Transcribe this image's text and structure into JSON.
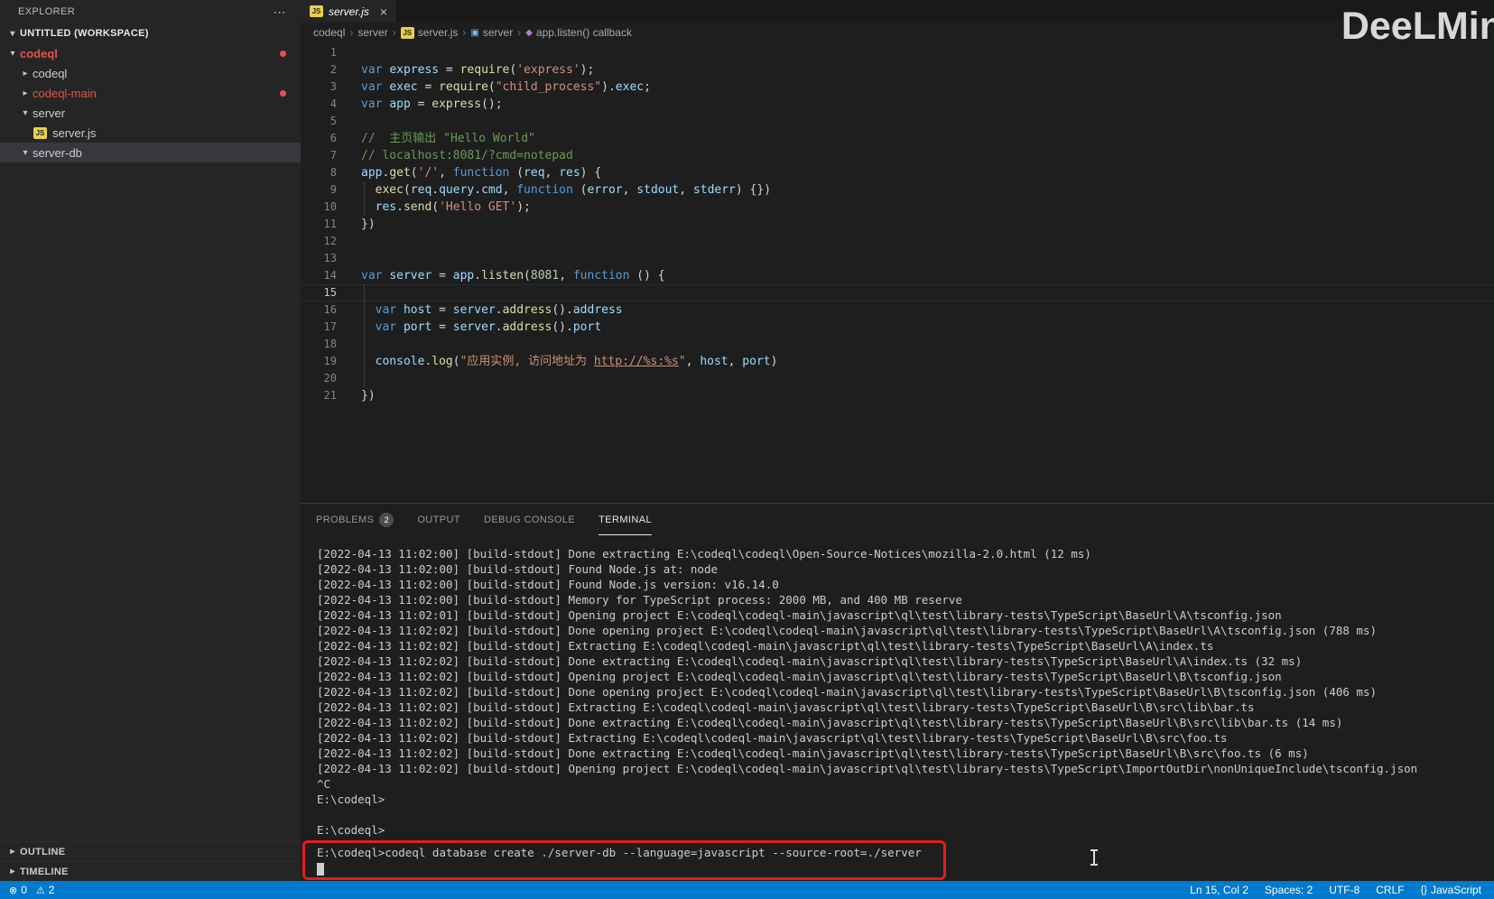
{
  "colors": {
    "status_bar": "#007acc",
    "red_highlight": "#e55349",
    "annotation": "#e51c1c",
    "js_badge": "#e8cf4e"
  },
  "watermark": "DeeLMin",
  "icons": {
    "js_label": "JS",
    "ellipsis": "⋯",
    "chevron_down": "▾",
    "chevron_right": "▸",
    "close": "×",
    "separator": "›",
    "symbol_field": "▣",
    "symbol_method": "◆"
  },
  "sidebar": {
    "header": "EXPLORER",
    "workspace_label": "UNTITLED (WORKSPACE)",
    "tree": [
      {
        "label": "codeql",
        "chevron": "expanded",
        "red": true,
        "bold": true,
        "dot": true,
        "indent": 0
      },
      {
        "label": "codeql",
        "chevron": "collapsed",
        "indent": 1
      },
      {
        "label": "codeql-main",
        "chevron": "collapsed",
        "red": true,
        "dot": true,
        "indent": 1
      },
      {
        "label": "server",
        "chevron": "expanded",
        "indent": 1
      },
      {
        "label": "server.js",
        "file": "js",
        "indent": 2
      },
      {
        "label": "server-db",
        "chevron": "expanded",
        "selected": true,
        "indent": 1
      }
    ],
    "sections": [
      "OUTLINE",
      "TIMELINE"
    ]
  },
  "editor": {
    "tab": {
      "label": "server.js"
    },
    "breadcrumbs": [
      {
        "label": "codeql"
      },
      {
        "label": "server"
      },
      {
        "label": "server.js",
        "icon": "js"
      },
      {
        "label": "server",
        "icon": "symbol-field"
      },
      {
        "label": "app.listen() callback",
        "icon": "symbol-method"
      }
    ],
    "code": {
      "current_line": 15,
      "lines": [
        [],
        [
          [
            "k",
            "var "
          ],
          [
            "v",
            "express"
          ],
          [
            "p",
            " = "
          ],
          [
            "f",
            "require"
          ],
          [
            "p",
            "("
          ],
          [
            "s",
            "'express'"
          ],
          [
            "p",
            ");"
          ]
        ],
        [
          [
            "k",
            "var "
          ],
          [
            "v",
            "exec"
          ],
          [
            "p",
            " = "
          ],
          [
            "f",
            "require"
          ],
          [
            "p",
            "("
          ],
          [
            "s",
            "\"child_process\""
          ],
          [
            "p",
            ")."
          ],
          [
            "v",
            "exec"
          ],
          [
            "p",
            ";"
          ]
        ],
        [
          [
            "k",
            "var "
          ],
          [
            "v",
            "app"
          ],
          [
            "p",
            " = "
          ],
          [
            "f",
            "express"
          ],
          [
            "p",
            "();"
          ]
        ],
        [],
        [
          [
            "c",
            "//  主页输出 \"Hello World\""
          ]
        ],
        [
          [
            "c",
            "// localhost:8081/?cmd=notepad"
          ]
        ],
        [
          [
            "v",
            "app"
          ],
          [
            "p",
            "."
          ],
          [
            "f",
            "get"
          ],
          [
            "p",
            "("
          ],
          [
            "s",
            "'/'"
          ],
          [
            "p",
            ", "
          ],
          [
            "k",
            "function"
          ],
          [
            "p",
            " ("
          ],
          [
            "v",
            "req"
          ],
          [
            "p",
            ", "
          ],
          [
            "v",
            "res"
          ],
          [
            "p",
            ") {"
          ]
        ],
        [
          [
            "p",
            "  "
          ],
          [
            "f",
            "exec"
          ],
          [
            "p",
            "("
          ],
          [
            "v",
            "req"
          ],
          [
            "p",
            "."
          ],
          [
            "v",
            "query"
          ],
          [
            "p",
            "."
          ],
          [
            "v",
            "cmd"
          ],
          [
            "p",
            ", "
          ],
          [
            "k",
            "function"
          ],
          [
            "p",
            " ("
          ],
          [
            "v",
            "error"
          ],
          [
            "p",
            ", "
          ],
          [
            "v",
            "stdout"
          ],
          [
            "p",
            ", "
          ],
          [
            "v",
            "stderr"
          ],
          [
            "p",
            ") {})"
          ]
        ],
        [
          [
            "p",
            "  "
          ],
          [
            "v",
            "res"
          ],
          [
            "p",
            "."
          ],
          [
            "f",
            "send"
          ],
          [
            "p",
            "("
          ],
          [
            "s",
            "'Hello GET'"
          ],
          [
            "p",
            ");"
          ]
        ],
        [
          [
            "p",
            "})"
          ]
        ],
        [],
        [],
        [
          [
            "k",
            "var "
          ],
          [
            "v",
            "server"
          ],
          [
            "p",
            " = "
          ],
          [
            "v",
            "app"
          ],
          [
            "p",
            "."
          ],
          [
            "f",
            "listen"
          ],
          [
            "p",
            "("
          ],
          [
            "n",
            "8081"
          ],
          [
            "p",
            ", "
          ],
          [
            "k",
            "function"
          ],
          [
            "p",
            " () {"
          ]
        ],
        [],
        [
          [
            "p",
            "  "
          ],
          [
            "k",
            "var "
          ],
          [
            "v",
            "host"
          ],
          [
            "p",
            " = "
          ],
          [
            "v",
            "server"
          ],
          [
            "p",
            "."
          ],
          [
            "f",
            "address"
          ],
          [
            "p",
            "()."
          ],
          [
            "v",
            "address"
          ]
        ],
        [
          [
            "p",
            "  "
          ],
          [
            "k",
            "var "
          ],
          [
            "v",
            "port"
          ],
          [
            "p",
            " = "
          ],
          [
            "v",
            "server"
          ],
          [
            "p",
            "."
          ],
          [
            "f",
            "address"
          ],
          [
            "p",
            "()."
          ],
          [
            "v",
            "port"
          ]
        ],
        [],
        [
          [
            "p",
            "  "
          ],
          [
            "v",
            "console"
          ],
          [
            "p",
            "."
          ],
          [
            "f",
            "log"
          ],
          [
            "p",
            "("
          ],
          [
            "s",
            "\"应用实例, 访问地址为 "
          ],
          [
            "l",
            "http://%s:%s"
          ],
          [
            "s",
            "\""
          ],
          [
            "p",
            ", "
          ],
          [
            "v",
            "host"
          ],
          [
            "p",
            ", "
          ],
          [
            "v",
            "port"
          ],
          [
            "p",
            ")"
          ]
        ],
        [],
        [
          [
            "p",
            "})"
          ]
        ]
      ]
    }
  },
  "panel": {
    "tabs": [
      {
        "label": "PROBLEMS",
        "badge": "2"
      },
      {
        "label": "OUTPUT"
      },
      {
        "label": "DEBUG CONSOLE"
      },
      {
        "label": "TERMINAL",
        "active": true
      }
    ]
  },
  "terminal": {
    "lines": [
      "[2022-04-13 11:02:00] [build-stdout] Done extracting E:\\codeql\\codeql\\Open-Source-Notices\\mozilla-2.0.html (12 ms)",
      "[2022-04-13 11:02:00] [build-stdout] Found Node.js at: node",
      "[2022-04-13 11:02:00] [build-stdout] Found Node.js version: v16.14.0",
      "[2022-04-13 11:02:00] [build-stdout] Memory for TypeScript process: 2000 MB, and 400 MB reserve",
      "[2022-04-13 11:02:01] [build-stdout] Opening project E:\\codeql\\codeql-main\\javascript\\ql\\test\\library-tests\\TypeScript\\BaseUrl\\A\\tsconfig.json",
      "[2022-04-13 11:02:02] [build-stdout] Done opening project E:\\codeql\\codeql-main\\javascript\\ql\\test\\library-tests\\TypeScript\\BaseUrl\\A\\tsconfig.json (788 ms)",
      "[2022-04-13 11:02:02] [build-stdout] Extracting E:\\codeql\\codeql-main\\javascript\\ql\\test\\library-tests\\TypeScript\\BaseUrl\\A\\index.ts",
      "[2022-04-13 11:02:02] [build-stdout] Done extracting E:\\codeql\\codeql-main\\javascript\\ql\\test\\library-tests\\TypeScript\\BaseUrl\\A\\index.ts (32 ms)",
      "[2022-04-13 11:02:02] [build-stdout] Opening project E:\\codeql\\codeql-main\\javascript\\ql\\test\\library-tests\\TypeScript\\BaseUrl\\B\\tsconfig.json",
      "[2022-04-13 11:02:02] [build-stdout] Done opening project E:\\codeql\\codeql-main\\javascript\\ql\\test\\library-tests\\TypeScript\\BaseUrl\\B\\tsconfig.json (406 ms)",
      "[2022-04-13 11:02:02] [build-stdout] Extracting E:\\codeql\\codeql-main\\javascript\\ql\\test\\library-tests\\TypeScript\\BaseUrl\\B\\src\\lib\\bar.ts",
      "[2022-04-13 11:02:02] [build-stdout] Done extracting E:\\codeql\\codeql-main\\javascript\\ql\\test\\library-tests\\TypeScript\\BaseUrl\\B\\src\\lib\\bar.ts (14 ms)",
      "[2022-04-13 11:02:02] [build-stdout] Extracting E:\\codeql\\codeql-main\\javascript\\ql\\test\\library-tests\\TypeScript\\BaseUrl\\B\\src\\foo.ts",
      "[2022-04-13 11:02:02] [build-stdout] Done extracting E:\\codeql\\codeql-main\\javascript\\ql\\test\\library-tests\\TypeScript\\BaseUrl\\B\\src\\foo.ts (6 ms)",
      "[2022-04-13 11:02:02] [build-stdout] Opening project E:\\codeql\\codeql-main\\javascript\\ql\\test\\library-tests\\TypeScript\\ImportOutDir\\nonUniqueInclude\\tsconfig.json",
      "^C",
      "E:\\codeql>",
      "",
      "E:\\codeql>"
    ],
    "command": "E:\\codeql>codeql database create ./server-db --language=javascript --source-root=./server"
  },
  "status_bar": {
    "left": [
      {
        "name": "errors",
        "icon": "error-icon",
        "glyph": "⊗",
        "value": "0"
      },
      {
        "name": "warnings",
        "icon": "warning-icon",
        "glyph": "⚠",
        "value": "2"
      }
    ],
    "right": [
      {
        "name": "cursor-position",
        "label": "Ln 15, Col 2"
      },
      {
        "name": "indentation",
        "label": "Spaces: 2"
      },
      {
        "name": "encoding",
        "label": "UTF-8"
      },
      {
        "name": "eol",
        "label": "CRLF"
      },
      {
        "name": "language-mode",
        "icon": "braces-icon",
        "glyph": "{}",
        "label": "JavaScript"
      }
    ]
  }
}
